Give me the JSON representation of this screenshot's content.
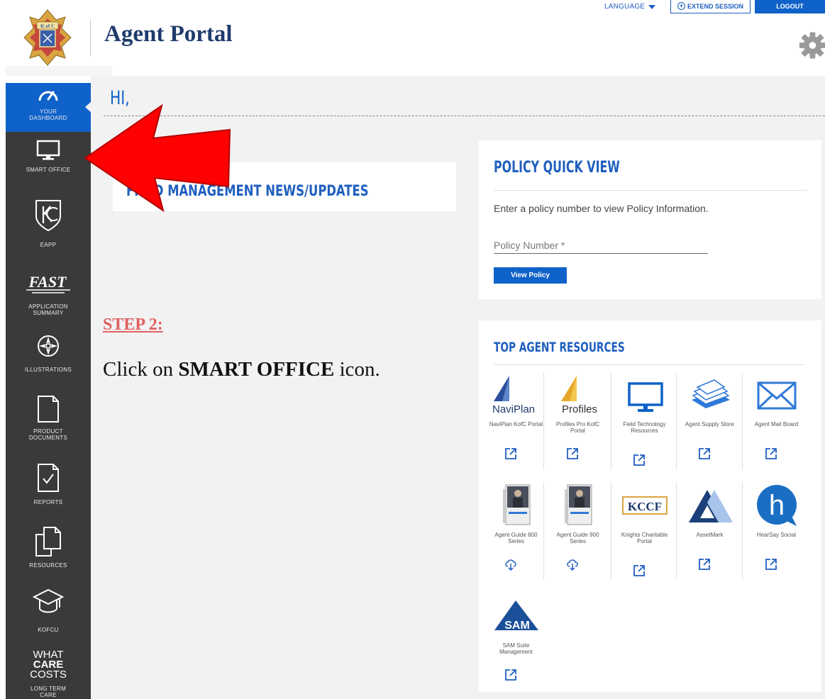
{
  "header": {
    "logo_text": "K of C",
    "title": "Agent Portal",
    "language_label": "LANGUAGE",
    "extend_label": "EXTEND SESSION",
    "logout_label": "LOGOUT",
    "settings_icon": "gear-icon"
  },
  "sidebar": {
    "items": [
      {
        "label": "YOUR DASHBOARD",
        "icon": "gauge-icon",
        "active": true
      },
      {
        "label": "SMART OFFICE",
        "icon": "monitor-icon"
      },
      {
        "label": "EAPP",
        "icon": "kc-shield-icon"
      },
      {
        "label": "APPLICATION SUMMARY",
        "icon": "fast-logo-icon",
        "logo_text": "FAST"
      },
      {
        "label": "ILLUSTRATIONS",
        "icon": "compass-icon"
      },
      {
        "label": "PRODUCT DOCUMENTS",
        "icon": "document-icon"
      },
      {
        "label": "REPORTS",
        "icon": "checked-document-icon"
      },
      {
        "label": "RESOURCES",
        "icon": "stacked-pages-icon"
      },
      {
        "label": "KOFCU",
        "icon": "graduation-cap-icon"
      },
      {
        "label": "LONG TERM CARE",
        "icon": "what-care-costs-logo",
        "logo_lines": [
          "WHAT",
          "CARE",
          "COSTS"
        ]
      }
    ]
  },
  "main": {
    "greeting": "HI,",
    "news_title": "FIELD MANAGEMENT NEWS/UPDATES",
    "policy": {
      "heading": "POLICY QUICK VIEW",
      "description": "Enter a policy number to view Policy Information.",
      "input_placeholder": "Policy Number *",
      "input_value": "",
      "button_label": "View Policy"
    },
    "resources": {
      "heading": "TOP AGENT RESOURCES",
      "tiles": [
        {
          "label": "NaviPlan KofC Portal",
          "icon": "naviplan-logo",
          "logo_text": "NaviPlan",
          "action": "external-link-icon"
        },
        {
          "label": "Profiles Pro KofC Portal",
          "icon": "profiles-logo",
          "logo_text": "Profiles",
          "action": "external-link-icon"
        },
        {
          "label": "Field Technology Resources",
          "icon": "monitor-icon",
          "action": "external-link-icon"
        },
        {
          "label": "Agent Supply Store",
          "icon": "paper-stack-icon",
          "action": "external-link-icon"
        },
        {
          "label": "Agent Mail Board",
          "icon": "envelope-icon",
          "action": "external-link-icon"
        },
        {
          "label": "Agent Guide 800 Series",
          "icon": "guide-cover-icon",
          "action": "cloud-download-icon"
        },
        {
          "label": "Agent Guide 900 Series",
          "icon": "guide-cover-icon",
          "action": "cloud-download-icon"
        },
        {
          "label": "Knights Charitable Portal",
          "icon": "kccf-logo",
          "logo_text": "KCCF",
          "action": "external-link-icon"
        },
        {
          "label": "AssetMark",
          "icon": "assetmark-logo",
          "action": "external-link-icon"
        },
        {
          "label": "HearSay Social",
          "icon": "hearsay-logo",
          "logo_text": "h",
          "action": "external-link-icon"
        },
        {
          "label": "SAM Suite Management",
          "icon": "sam-logo",
          "logo_text": "SAM",
          "action": "external-link-icon"
        }
      ]
    }
  },
  "instruction": {
    "step": "STEP 2:",
    "text_before": "Click on ",
    "text_bold": "SMART OFFICE",
    "text_after": " icon.",
    "arrow_color": "#ff0000"
  },
  "colors": {
    "brand_blue": "#0f62c9",
    "heading_blue": "#1f5fbf",
    "sidebar_bg": "#3a3a3a",
    "title_navy": "#1f3b6d"
  }
}
